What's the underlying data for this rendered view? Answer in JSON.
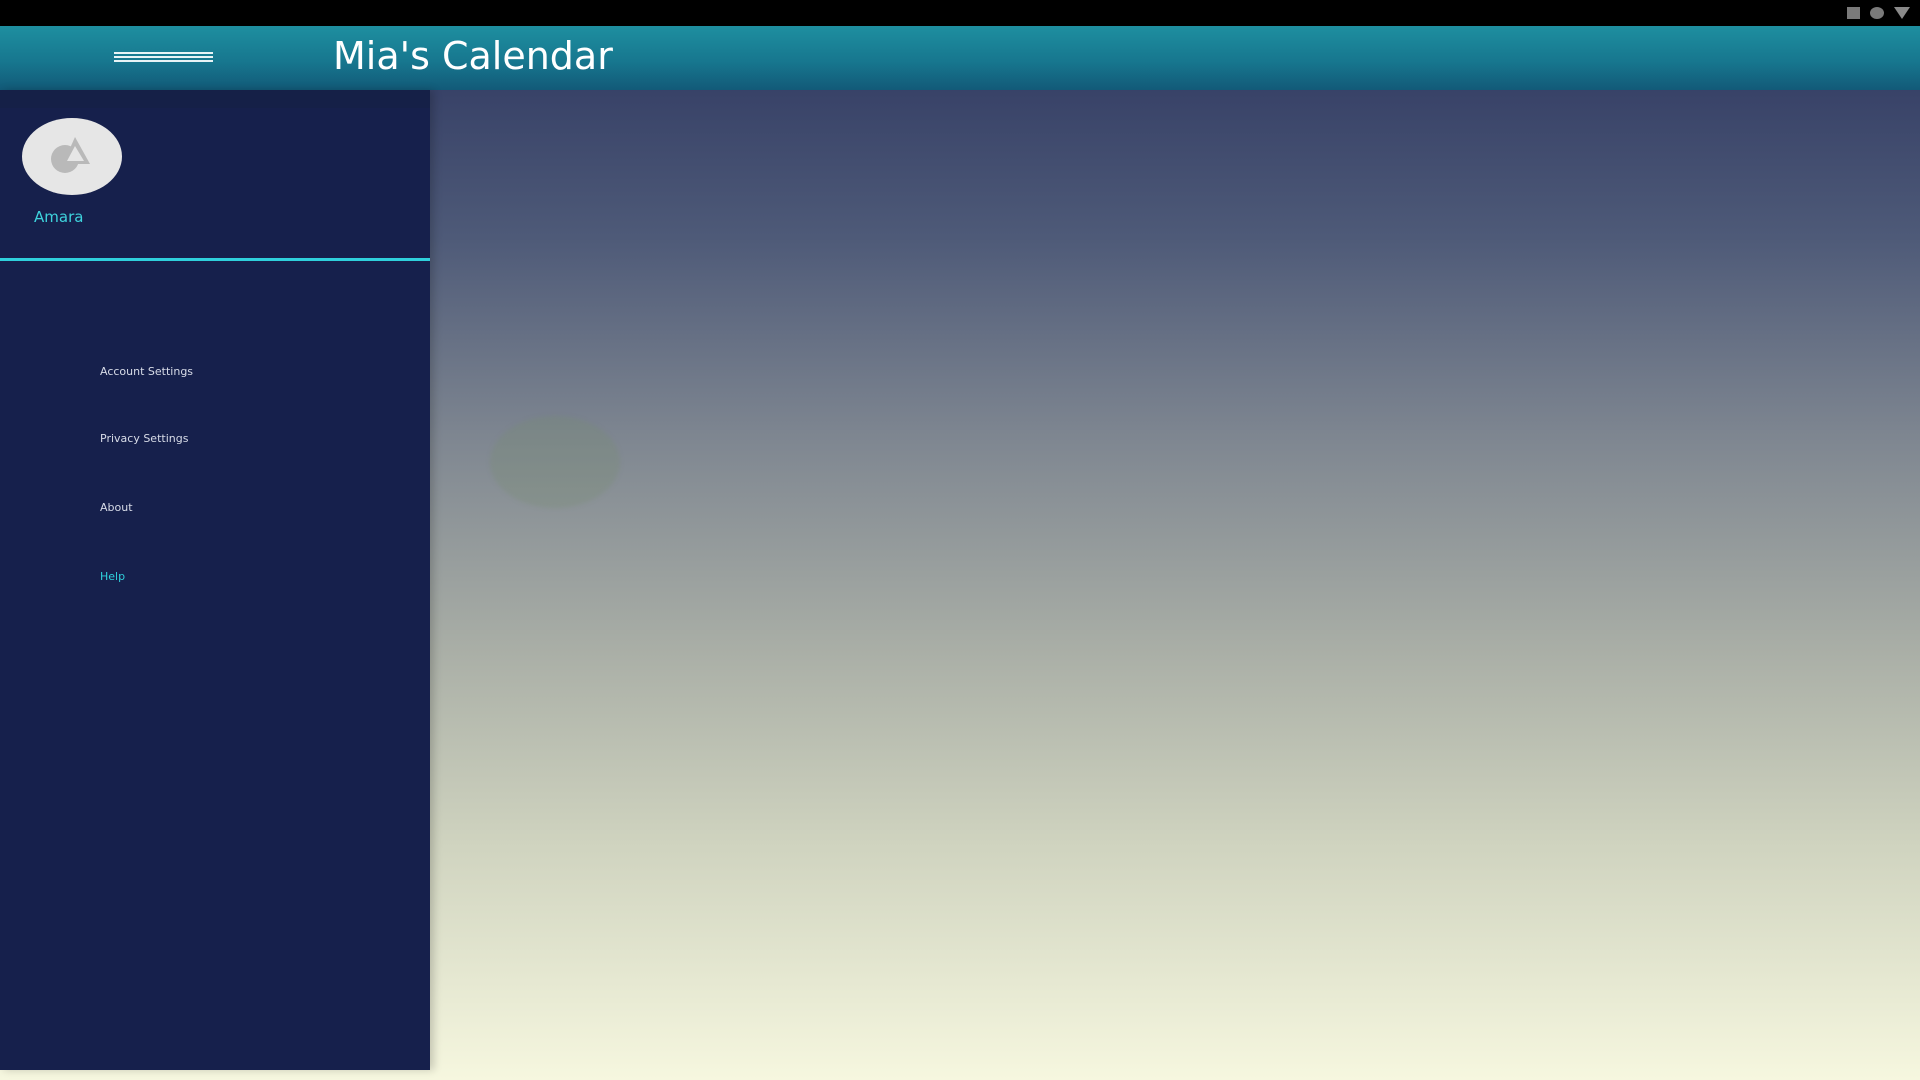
{
  "app": {
    "title": "Mia's Calendar"
  },
  "status_bar": {
    "icons": [
      "square-icon",
      "circle-icon",
      "triangle-icon"
    ]
  },
  "drawer": {
    "user_name": "Amara",
    "items": [
      {
        "label": "Account Settings",
        "active": false
      },
      {
        "label": "Privacy Settings",
        "active": false
      },
      {
        "label": "About",
        "active": false
      },
      {
        "label": "Help",
        "active": true
      }
    ]
  },
  "colors": {
    "app_bar": "#1e8fa0",
    "drawer_bg": "#16204c",
    "accent": "#2fd0dc",
    "status_bar": "#000000"
  }
}
